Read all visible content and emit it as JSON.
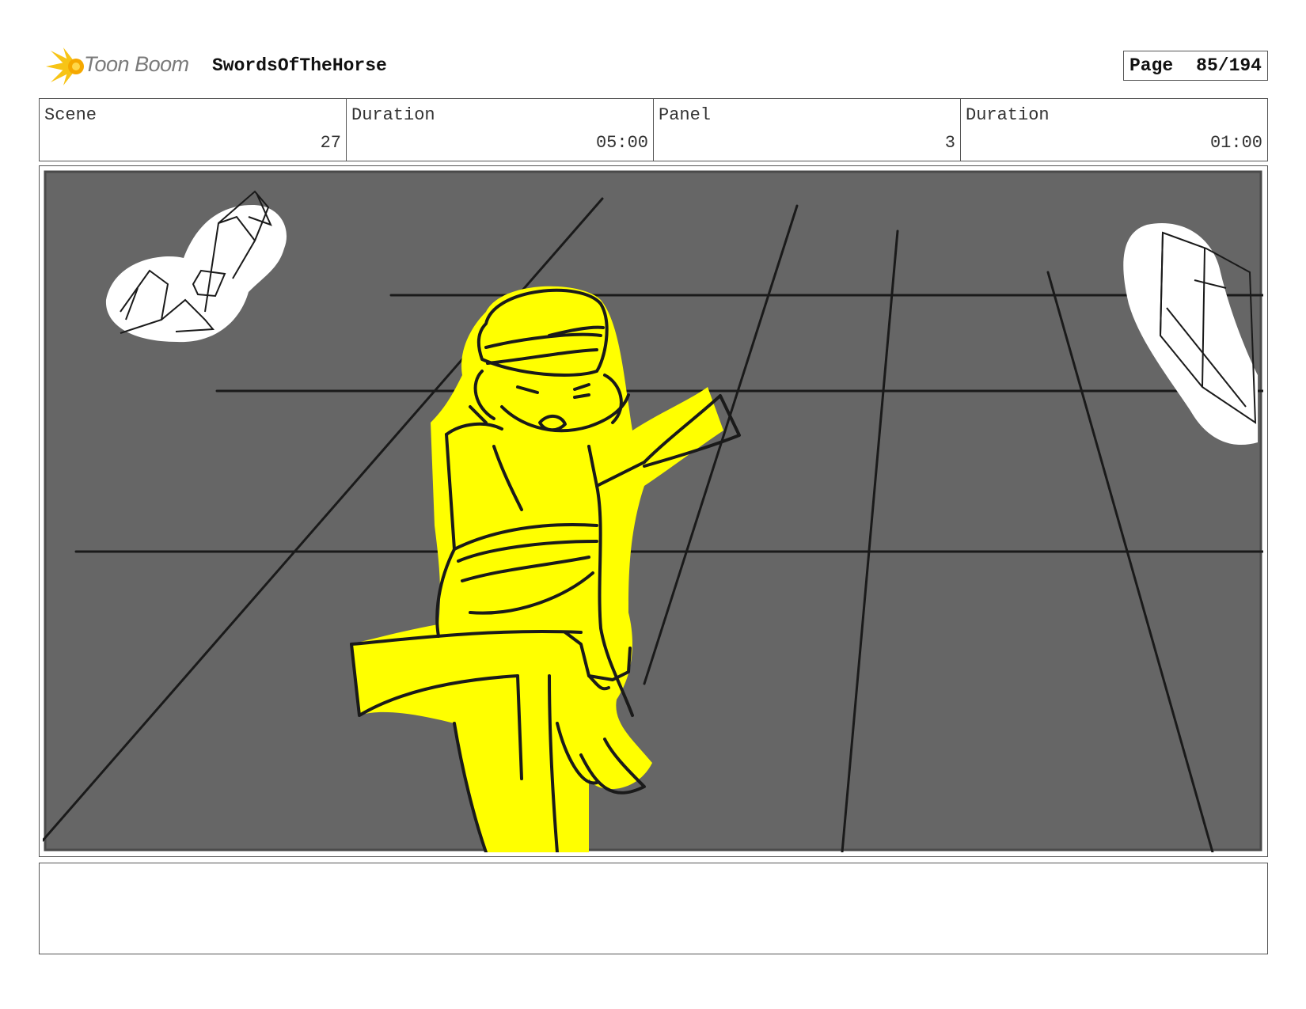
{
  "header": {
    "logo_text": "Toon Boom",
    "project_title": "SwordsOfTheHorse",
    "page_label": "Page",
    "page_number": "85/194"
  },
  "info": {
    "scene_label": "Scene",
    "scene_value": "27",
    "scene_duration_label": "Duration",
    "scene_duration_value": "05:00",
    "panel_label": "Panel",
    "panel_value": "3",
    "panel_duration_label": "Duration",
    "panel_duration_value": "01:00"
  },
  "notes": {
    "text": ""
  },
  "colors": {
    "logo_accent": "#f7c416",
    "panel_background": "#666666",
    "character_fill": "#ffff00",
    "line": "#1a1a1a"
  }
}
